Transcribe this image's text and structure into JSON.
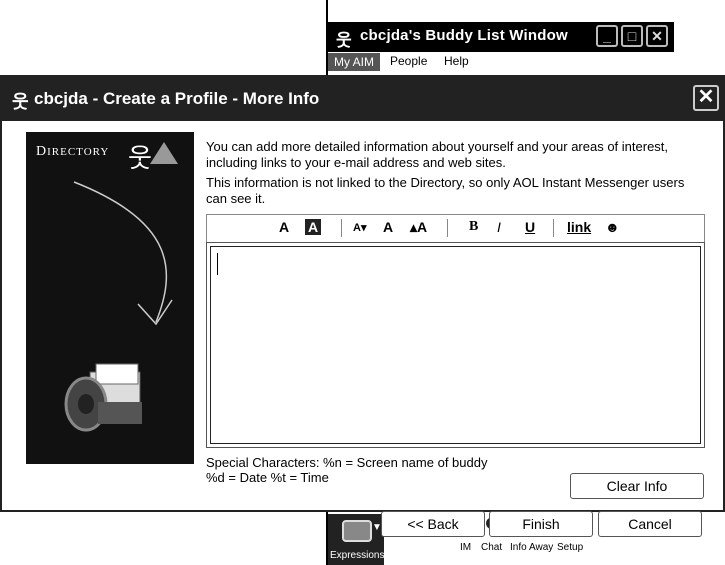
{
  "buddy_window": {
    "title": "cbcjda's Buddy List Window",
    "menu": [
      "My AIM",
      "People",
      "Help"
    ],
    "bottom": {
      "expressions_label": "Expressions",
      "buttons": [
        {
          "label": "IM",
          "icon": "im-icon"
        },
        {
          "label": "Chat",
          "icon": "chat-icon"
        },
        {
          "label": "Info",
          "icon": "info-icon"
        },
        {
          "label": "Away",
          "icon": "away-icon"
        },
        {
          "label": "Setup",
          "icon": "setup-icon"
        }
      ]
    }
  },
  "dialog": {
    "title": "cbcjda - Create a Profile - More Info",
    "directory_label_big": "D",
    "directory_label_rest": "IRECTORY",
    "intro_1": "You can add more detailed information about yourself and your areas of interest, including links to your e-mail address and web sites.",
    "intro_2": "This information is not linked to the Directory, so only AOL Instant Messenger users can see it.",
    "toolbar": [
      {
        "name": "text-color-button",
        "label": "A"
      },
      {
        "name": "background-color-button",
        "label": "A"
      },
      {
        "name": "decrease-font-button",
        "label": "A▾"
      },
      {
        "name": "normal-font-button",
        "label": "A"
      },
      {
        "name": "increase-font-button",
        "label": "▴A"
      },
      {
        "name": "bold-button",
        "label": "B"
      },
      {
        "name": "italic-button",
        "label": "I"
      },
      {
        "name": "underline-button",
        "label": "U"
      },
      {
        "name": "link-button",
        "label": "link"
      },
      {
        "name": "smiley-button",
        "label": "☻"
      }
    ],
    "editor_value": "",
    "special_line_1": "Special Characters:  %n = Screen name of buddy",
    "special_line_2": "%d = Date   %t = Time",
    "buttons": {
      "clear": "Clear Info",
      "back": "<< Back",
      "finish": "Finish",
      "cancel": "Cancel"
    }
  }
}
